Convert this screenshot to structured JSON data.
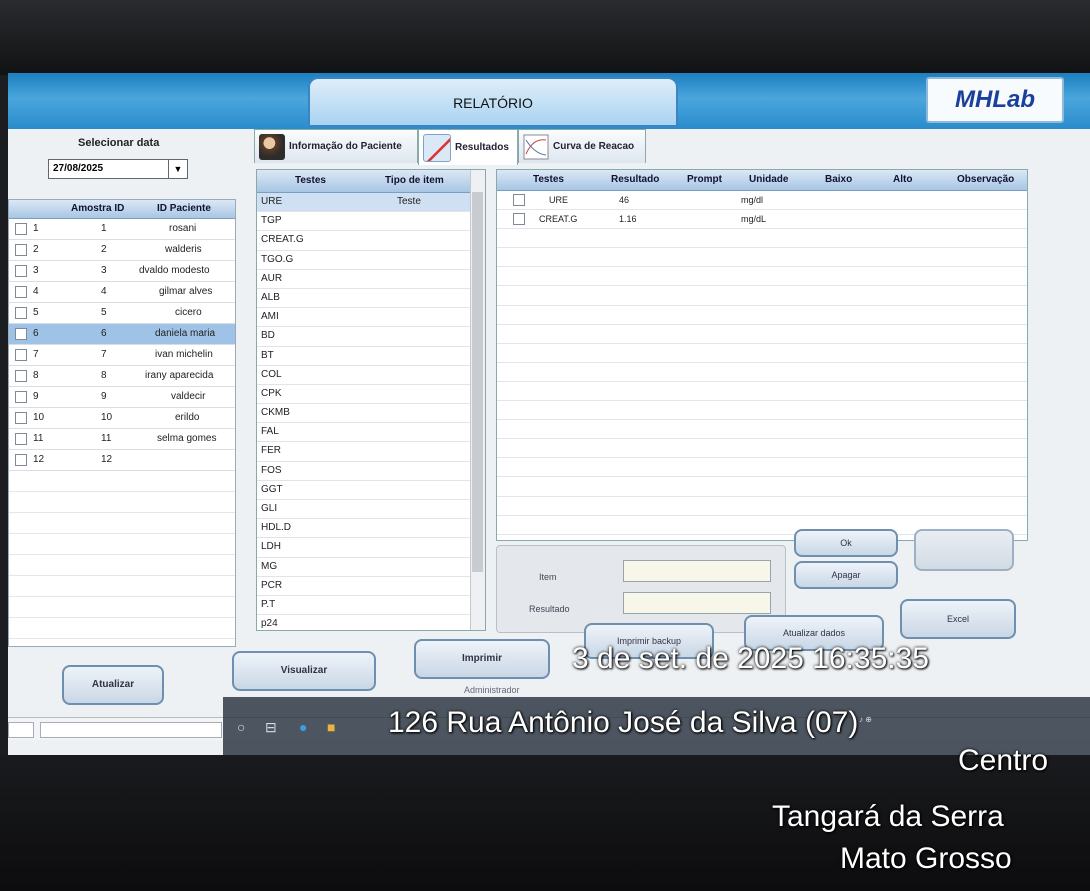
{
  "header": {
    "title": "RELATÓRIO",
    "logo": "MHLab"
  },
  "left_panel": {
    "date_label": "Selecionar data",
    "date_value": "27/08/2025",
    "columns": [
      "Amostra ID",
      "ID Paciente"
    ],
    "rows": [
      {
        "n": "1",
        "amostra": "1",
        "paciente": "rosani"
      },
      {
        "n": "2",
        "amostra": "2",
        "paciente": "walderis"
      },
      {
        "n": "3",
        "amostra": "3",
        "paciente": "dvaldo modesto"
      },
      {
        "n": "4",
        "amostra": "4",
        "paciente": "gilmar alves"
      },
      {
        "n": "5",
        "amostra": "5",
        "paciente": "cicero"
      },
      {
        "n": "6",
        "amostra": "6",
        "paciente": "daniela maria"
      },
      {
        "n": "7",
        "amostra": "7",
        "paciente": "ivan michelin"
      },
      {
        "n": "8",
        "amostra": "8",
        "paciente": "irany aparecida"
      },
      {
        "n": "9",
        "amostra": "9",
        "paciente": "valdecir"
      },
      {
        "n": "10",
        "amostra": "10",
        "paciente": "erildo"
      },
      {
        "n": "11",
        "amostra": "11",
        "paciente": "selma gomes"
      },
      {
        "n": "12",
        "amostra": "12",
        "paciente": ""
      }
    ]
  },
  "tabs": [
    {
      "label": "Informação do Paciente",
      "icon": "patients-icon"
    },
    {
      "label": "Resultados",
      "icon": "results-icon"
    },
    {
      "label": "Curva de Reacao",
      "icon": "reaction-curve-icon"
    }
  ],
  "tests_list": {
    "columns": [
      "Testes",
      "Tipo de item"
    ],
    "rows": [
      {
        "test": "URE",
        "type": "Teste"
      },
      {
        "test": "TGP",
        "type": ""
      },
      {
        "test": "CREAT.G",
        "type": ""
      },
      {
        "test": "TGO.G",
        "type": ""
      },
      {
        "test": "AUR",
        "type": ""
      },
      {
        "test": "ALB",
        "type": ""
      },
      {
        "test": "AMI",
        "type": ""
      },
      {
        "test": "BD",
        "type": ""
      },
      {
        "test": "BT",
        "type": ""
      },
      {
        "test": "COL",
        "type": ""
      },
      {
        "test": "CPK",
        "type": ""
      },
      {
        "test": "CKMB",
        "type": ""
      },
      {
        "test": "FAL",
        "type": ""
      },
      {
        "test": "FER",
        "type": ""
      },
      {
        "test": "FOS",
        "type": ""
      },
      {
        "test": "GGT",
        "type": ""
      },
      {
        "test": "GLI",
        "type": ""
      },
      {
        "test": "HDL.D",
        "type": ""
      },
      {
        "test": "LDH",
        "type": ""
      },
      {
        "test": "MG",
        "type": ""
      },
      {
        "test": "PCR",
        "type": ""
      },
      {
        "test": "P.T",
        "type": ""
      },
      {
        "test": "p24",
        "type": ""
      }
    ]
  },
  "results": {
    "columns": [
      "Testes",
      "Resultado",
      "Prompt",
      "Unidade",
      "Baixo",
      "Alto",
      "Observação"
    ],
    "rows": [
      {
        "test": "URE",
        "result": "46",
        "unit": "mg/dl"
      },
      {
        "test": "CREAT.G",
        "result": "1.16",
        "unit": "mg/dL"
      }
    ]
  },
  "edit_box": {
    "item_label": "Item",
    "result_label": "Resultado"
  },
  "buttons": {
    "ok": "Ok",
    "apagar": "Apagar",
    "imprimir_backup": "Imprimir backup",
    "atualizar_dados": "Atualizar dados",
    "excel": "Excel",
    "atualizar": "Atualizar",
    "visualizar": "Visualizar",
    "imprimir": "Imprimir"
  },
  "status_bar": {
    "user": "Administrador"
  },
  "overlay": {
    "datetime": "3 de set. de 2025 16:35:35",
    "address": "126 Rua Antônio José da Silva (07)",
    "district": "Centro",
    "city": "Tangará da Serra",
    "state": "Mato Grosso"
  },
  "colors": {
    "header_blue": "#2b8ccc",
    "selection": "#9fc3e6",
    "logo": "#1a3f9c"
  }
}
